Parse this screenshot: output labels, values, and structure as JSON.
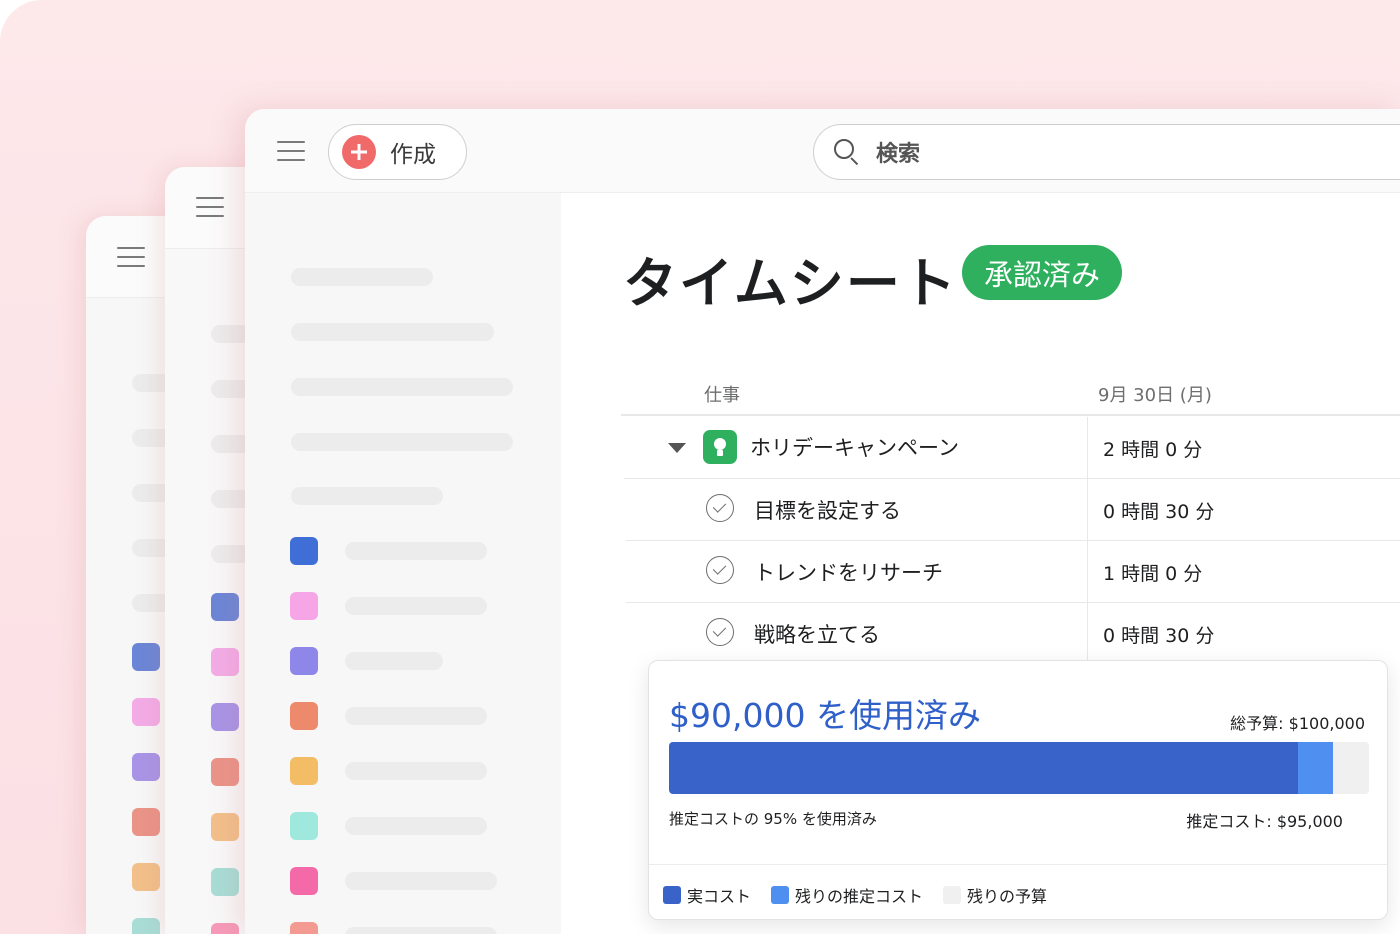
{
  "app": {
    "create_label": "作成",
    "search_placeholder": "検索"
  },
  "page": {
    "title": "タイムシート",
    "status_badge": "承認済み"
  },
  "table": {
    "columns": [
      "仕事",
      "9月 30日 (月)"
    ],
    "rows": [
      {
        "name": "ホリデーキャンペーン",
        "time": "2 時間 0 分",
        "kind": "project"
      },
      {
        "name": "目標を設定する",
        "time": "0 時間 30 分",
        "kind": "task"
      },
      {
        "name": "トレンドをリサーチ",
        "time": "1 時間 0 分",
        "kind": "task"
      },
      {
        "name": "戦略を立てる",
        "time": "0 時間 30 分",
        "kind": "task"
      }
    ]
  },
  "budget": {
    "used_title": "$90,000 を使用済み",
    "total_budget": "総予算: $100,000",
    "percent_text": "推定コストの 95% を使用済み",
    "estimated_cost": "推定コスト: $95,000",
    "actual_fraction": 0.9,
    "estimated_fraction": 0.95,
    "legend": [
      {
        "label": "実コスト",
        "color": "#3a63c9"
      },
      {
        "label": "残りの推定コスト",
        "color": "#4f8ff0"
      },
      {
        "label": "残りの予算",
        "color": "#f0f0f0"
      }
    ]
  },
  "colors": {
    "accent_green": "#2fb05e",
    "create_red": "#f06a6a",
    "budget_blue": "#2f5fc8"
  },
  "sidebar_swatches": [
    "#3f6fd6",
    "#f6a6e6",
    "#8e86e8",
    "#ee8a6c",
    "#f2bd64",
    "#9ee8de",
    "#f46aa8",
    "#f39a92"
  ],
  "back_swatches_2": [
    "#6b86d6",
    "#f3ace6",
    "#a894e6",
    "#ea9488",
    "#f2c08a",
    "#a8ddd6",
    "#f59ab8"
  ],
  "back_swatches_3": [
    "#6b86d6",
    "#f3ace6",
    "#a894e6",
    "#ea9488",
    "#f2c08a",
    "#a8ddd6"
  ]
}
